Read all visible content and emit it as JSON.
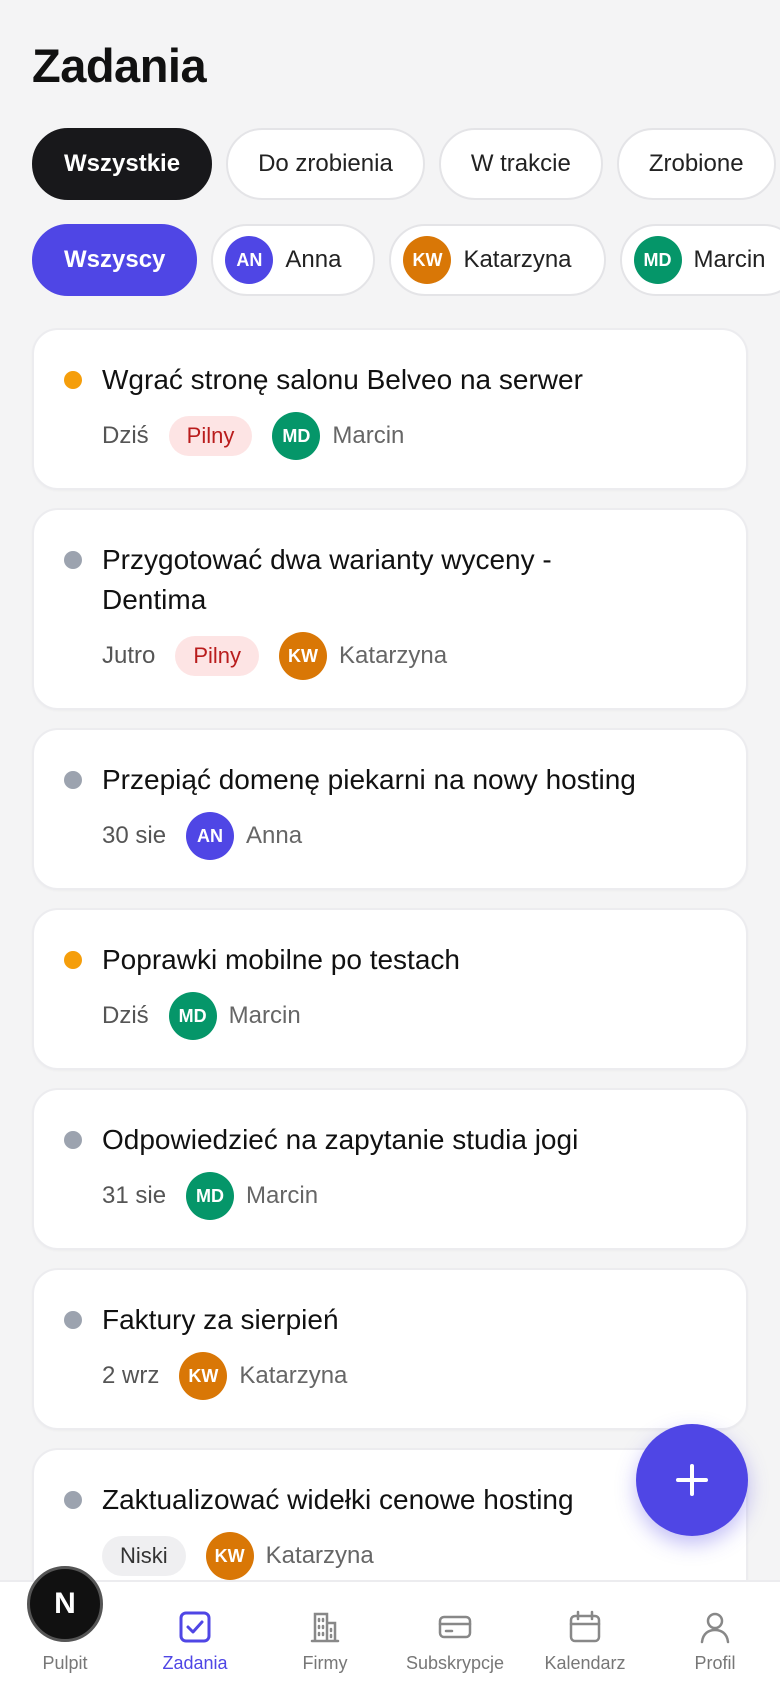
{
  "header": {
    "title": "Zadania"
  },
  "status_filters": [
    {
      "label": "Wszystkie",
      "active": true
    },
    {
      "label": "Do zrobienia",
      "active": false
    },
    {
      "label": "W trakcie",
      "active": false
    },
    {
      "label": "Zrobione",
      "active": false
    }
  ],
  "people_filters": {
    "all_label": "Wszyscy",
    "people": [
      {
        "initials": "AN",
        "name": "Anna",
        "color": "#4f46e5"
      },
      {
        "initials": "KW",
        "name": "Katarzyna",
        "color": "#d97706"
      },
      {
        "initials": "MD",
        "name": "Marcin",
        "color": "#059669"
      }
    ]
  },
  "tasks": [
    {
      "title": "Wgrać stronę salonu Belveo na serwer",
      "dot_color": "#f59e0b",
      "date": "Dziś",
      "tag": "Pilny",
      "assignee_initials": "MD",
      "assignee_name": "Marcin"
    },
    {
      "title": "Przygotować dwa warianty wyceny - Dentima",
      "dot_color": "#9ca3af",
      "date": "Jutro",
      "tag": "Pilny",
      "assignee_initials": "KW",
      "assignee_name": "Katarzyna"
    },
    {
      "title": "Przepiąć domenę piekarni na nowy hosting",
      "dot_color": "#9ca3af",
      "date": "30 sie",
      "assignee_initials": "AN",
      "assignee_name": "Anna"
    },
    {
      "title": "Poprawki mobilne po testach",
      "dot_color": "#f59e0b",
      "date": "Dziś",
      "assignee_initials": "MD",
      "assignee_name": "Marcin"
    },
    {
      "title": "Odpowiedzieć na zapytanie studia jogi",
      "dot_color": "#9ca3af",
      "date": "31 sie",
      "assignee_initials": "MD",
      "assignee_name": "Marcin"
    },
    {
      "title": "Faktury za sierpień",
      "dot_color": "#9ca3af",
      "date": "2 wrz",
      "assignee_initials": "KW",
      "assignee_name": "Katarzyna"
    },
    {
      "title": "Zaktualizować widełki cenowe hosting",
      "dot_color": "#9ca3af",
      "tag": "Niski",
      "assignee_initials": "KW",
      "assignee_name": "Katarzyna"
    }
  ],
  "nav": {
    "logo_letter": "N",
    "items": [
      {
        "label": "Pulpit",
        "icon": "logo-icon"
      },
      {
        "label": "Zadania",
        "icon": "check-square-icon",
        "active": true
      },
      {
        "label": "Firmy",
        "icon": "building-icon"
      },
      {
        "label": "Subskrypcje",
        "icon": "credit-card-icon"
      },
      {
        "label": "Kalendarz",
        "icon": "calendar-icon"
      },
      {
        "label": "Profil",
        "icon": "user-icon"
      }
    ]
  },
  "colors": {
    "accent": "#4f46e5",
    "dark": "#18181b",
    "urgent_bg": "#fde4e4",
    "urgent_text": "#b91c1c"
  }
}
